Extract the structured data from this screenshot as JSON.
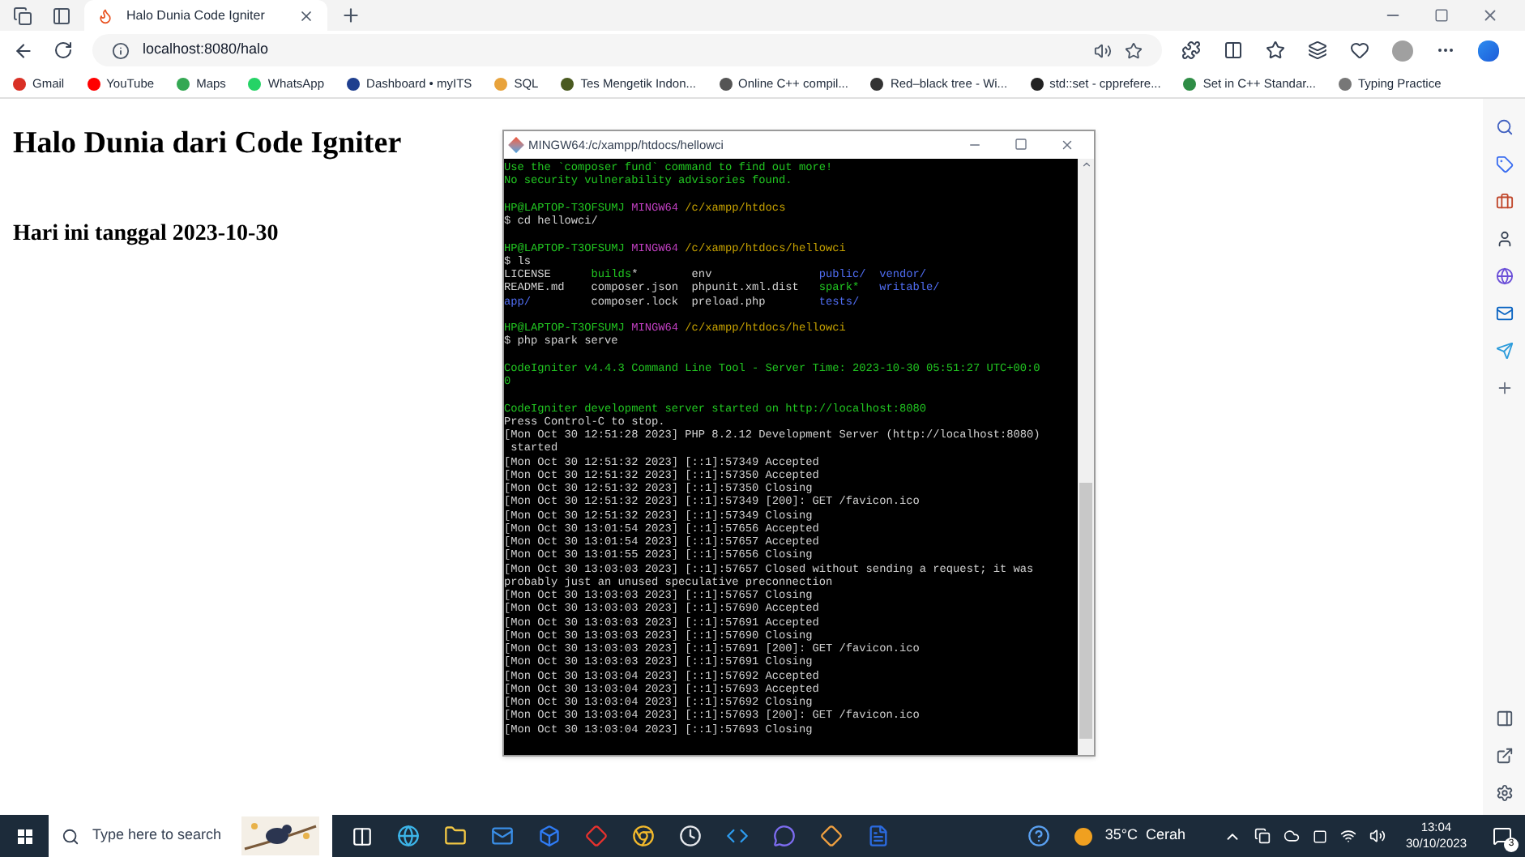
{
  "browser": {
    "tab": {
      "title": "Halo Dunia Code Igniter",
      "selected": true
    },
    "address": "localhost:8080/halo",
    "bookmarks": [
      {
        "label": "Gmail",
        "color": "#d93025"
      },
      {
        "label": "YouTube",
        "color": "#ff0000"
      },
      {
        "label": "Maps",
        "color": "#34a853"
      },
      {
        "label": "WhatsApp",
        "color": "#25d366"
      },
      {
        "label": "Dashboard • myITS",
        "color": "#1f3f8f"
      },
      {
        "label": "SQL",
        "color": "#e8a33c"
      },
      {
        "label": "Tes Mengetik Indon...",
        "color": "#4a5a20"
      },
      {
        "label": "Online C++ compil...",
        "color": "#555555"
      },
      {
        "label": "Red–black tree - Wi...",
        "color": "#333333"
      },
      {
        "label": "std::set - cpprefere...",
        "color": "#222222"
      },
      {
        "label": "Set in C++ Standar...",
        "color": "#2f8d46"
      },
      {
        "label": "Typing Practice",
        "color": "#777777"
      }
    ]
  },
  "page": {
    "heading": "Halo Dunia dari Code Igniter",
    "subheading": "Hari ini tanggal 2023-10-30"
  },
  "terminal": {
    "title": "MINGW64:/c/xampp/htdocs/hellowci",
    "lines": [
      {
        "segments": [
          {
            "text": "Use the `composer fund` command to find out more!",
            "color": "#21c421"
          }
        ]
      },
      {
        "segments": [
          {
            "text": "No security vulnerability advisories found.",
            "color": "#21c421"
          }
        ]
      },
      {
        "kind": "blank"
      },
      {
        "segments": [
          {
            "text": "HP@LAPTOP-T3OFSUMJ ",
            "color": "#21c421"
          },
          {
            "text": "MINGW64 ",
            "color": "#c23fc2"
          },
          {
            "text": "/c/xampp/htdocs",
            "color": "#c4a000"
          }
        ]
      },
      {
        "segments": [
          {
            "text": "$ cd hellowci/",
            "color": "#d0d0d0"
          }
        ]
      },
      {
        "kind": "blank"
      },
      {
        "segments": [
          {
            "text": "HP@LAPTOP-T3OFSUMJ ",
            "color": "#21c421"
          },
          {
            "text": "MINGW64 ",
            "color": "#c23fc2"
          },
          {
            "text": "/c/xampp/htdocs/hellowci",
            "color": "#c4a000"
          }
        ]
      },
      {
        "segments": [
          {
            "text": "$ ls",
            "color": "#d0d0d0"
          }
        ]
      },
      {
        "segments": [
          {
            "text": "LICENSE      ",
            "color": "#d0d0d0"
          },
          {
            "text": "builds",
            "color": "#21c421"
          },
          {
            "text": "*        env                ",
            "color": "#d0d0d0"
          },
          {
            "text": "public/  vendor/",
            "color": "#4f6cf0"
          }
        ]
      },
      {
        "segments": [
          {
            "text": "README.md    composer.json  phpunit.xml.dist   ",
            "color": "#d0d0d0"
          },
          {
            "text": "spark*",
            "color": "#21c421"
          },
          {
            "text": "   writable/",
            "color": "#4f6cf0"
          }
        ]
      },
      {
        "segments": [
          {
            "text": "app/",
            "color": "#4f6cf0"
          },
          {
            "text": "         composer.lock  preload.php        ",
            "color": "#d0d0d0"
          },
          {
            "text": "tests/",
            "color": "#4f6cf0"
          }
        ]
      },
      {
        "kind": "blank"
      },
      {
        "segments": [
          {
            "text": "HP@LAPTOP-T3OFSUMJ ",
            "color": "#21c421"
          },
          {
            "text": "MINGW64 ",
            "color": "#c23fc2"
          },
          {
            "text": "/c/xampp/htdocs/hellowci",
            "color": "#c4a000"
          }
        ]
      },
      {
        "segments": [
          {
            "text": "$ php spark serve",
            "color": "#d0d0d0"
          }
        ]
      },
      {
        "kind": "blank"
      },
      {
        "segments": [
          {
            "text": "CodeIgniter v4.4.3 Command Line Tool - Server Time: 2023-10-30 05:51:27 UTC+00:0",
            "color": "#21c421"
          }
        ]
      },
      {
        "segments": [
          {
            "text": "0",
            "color": "#21c421"
          }
        ]
      },
      {
        "kind": "blank"
      },
      {
        "segments": [
          {
            "text": "CodeIgniter development server started on http://localhost:8080",
            "color": "#21c421"
          }
        ]
      },
      {
        "segments": [
          {
            "text": "Press Control-C to stop.",
            "color": "#d0d0d0"
          }
        ]
      },
      {
        "segments": [
          {
            "text": "[Mon Oct 30 12:51:28 2023] PHP 8.2.12 Development Server (http://localhost:8080)",
            "color": "#d0d0d0"
          }
        ]
      },
      {
        "segments": [
          {
            "text": " started",
            "color": "#d0d0d0"
          }
        ]
      },
      {
        "segments": [
          {
            "text": "[Mon Oct 30 12:51:32 2023] [::1]:57349 Accepted",
            "color": "#d0d0d0"
          }
        ]
      },
      {
        "segments": [
          {
            "text": "[Mon Oct 30 12:51:32 2023] [::1]:57350 Accepted",
            "color": "#d0d0d0"
          }
        ]
      },
      {
        "segments": [
          {
            "text": "[Mon Oct 30 12:51:32 2023] [::1]:57350 Closing",
            "color": "#d0d0d0"
          }
        ]
      },
      {
        "segments": [
          {
            "text": "[Mon Oct 30 12:51:32 2023] [::1]:57349 [200]: GET /favicon.ico",
            "color": "#d0d0d0"
          }
        ]
      },
      {
        "segments": [
          {
            "text": "[Mon Oct 30 12:51:32 2023] [::1]:57349 Closing",
            "color": "#d0d0d0"
          }
        ]
      },
      {
        "segments": [
          {
            "text": "[Mon Oct 30 13:01:54 2023] [::1]:57656 Accepted",
            "color": "#d0d0d0"
          }
        ]
      },
      {
        "segments": [
          {
            "text": "[Mon Oct 30 13:01:54 2023] [::1]:57657 Accepted",
            "color": "#d0d0d0"
          }
        ]
      },
      {
        "segments": [
          {
            "text": "[Mon Oct 30 13:01:55 2023] [::1]:57656 Closing",
            "color": "#d0d0d0"
          }
        ]
      },
      {
        "segments": [
          {
            "text": "[Mon Oct 30 13:03:03 2023] [::1]:57657 Closed without sending a request; it was",
            "color": "#d0d0d0"
          }
        ]
      },
      {
        "segments": [
          {
            "text": "probably just an unused speculative preconnection",
            "color": "#d0d0d0"
          }
        ]
      },
      {
        "segments": [
          {
            "text": "[Mon Oct 30 13:03:03 2023] [::1]:57657 Closing",
            "color": "#d0d0d0"
          }
        ]
      },
      {
        "segments": [
          {
            "text": "[Mon Oct 30 13:03:03 2023] [::1]:57690 Accepted",
            "color": "#d0d0d0"
          }
        ]
      },
      {
        "segments": [
          {
            "text": "[Mon Oct 30 13:03:03 2023] [::1]:57691 Accepted",
            "color": "#d0d0d0"
          }
        ]
      },
      {
        "segments": [
          {
            "text": "[Mon Oct 30 13:03:03 2023] [::1]:57690 Closing",
            "color": "#d0d0d0"
          }
        ]
      },
      {
        "segments": [
          {
            "text": "[Mon Oct 30 13:03:03 2023] [::1]:57691 [200]: GET /favicon.ico",
            "color": "#d0d0d0"
          }
        ]
      },
      {
        "segments": [
          {
            "text": "[Mon Oct 30 13:03:03 2023] [::1]:57691 Closing",
            "color": "#d0d0d0"
          }
        ]
      },
      {
        "segments": [
          {
            "text": "[Mon Oct 30 13:03:04 2023] [::1]:57692 Accepted",
            "color": "#d0d0d0"
          }
        ]
      },
      {
        "segments": [
          {
            "text": "[Mon Oct 30 13:03:04 2023] [::1]:57693 Accepted",
            "color": "#d0d0d0"
          }
        ]
      },
      {
        "segments": [
          {
            "text": "[Mon Oct 30 13:03:04 2023] [::1]:57692 Closing",
            "color": "#d0d0d0"
          }
        ]
      },
      {
        "segments": [
          {
            "text": "[Mon Oct 30 13:03:04 2023] [::1]:57693 [200]: GET /favicon.ico",
            "color": "#d0d0d0"
          }
        ]
      },
      {
        "segments": [
          {
            "text": "[Mon Oct 30 13:03:04 2023] [::1]:57693 Closing",
            "color": "#d0d0d0"
          }
        ]
      }
    ]
  },
  "taskbar": {
    "search_placeholder": "Type here to search",
    "weather": "35°C  Cerah",
    "time": "13:04",
    "date": "30/10/2023",
    "notifications": "3"
  }
}
